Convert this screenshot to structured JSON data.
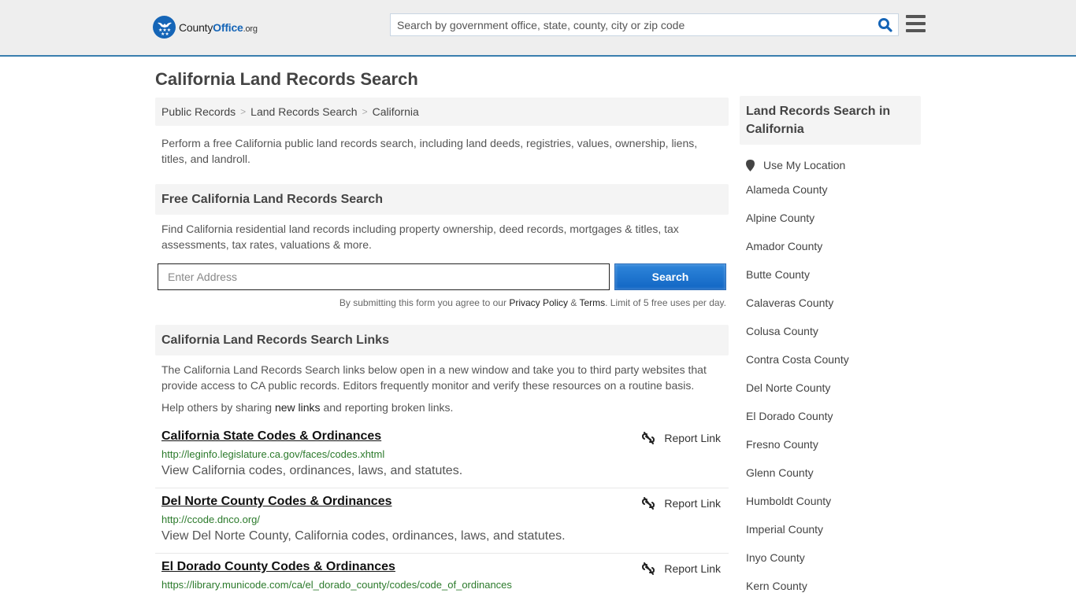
{
  "header": {
    "logo": {
      "county": "County",
      "office": "Office",
      "org": ".org"
    },
    "search_placeholder": "Search by government office, state, county, city or zip code",
    "brand_color": "#1565b7",
    "border_color": "#3a7eae"
  },
  "page_title": "California Land Records Search",
  "breadcrumb": [
    {
      "label": "Public Records"
    },
    {
      "label": "Land Records Search"
    },
    {
      "label": "California"
    }
  ],
  "intro": "Perform a free California public land records search, including land deeds, registries, values, ownership, liens, titles, and landroll.",
  "search_section": {
    "heading": "Free California Land Records Search",
    "description": "Find California residential land records including property ownership, deed records, mortgages & titles, tax assessments, tax rates, valuations & more.",
    "address_placeholder": "Enter Address",
    "button_label": "Search",
    "disclaimer_prefix": "By submitting this form you agree to our ",
    "privacy_label": "Privacy Policy",
    "amp": " & ",
    "terms_label": "Terms",
    "disclaimer_suffix": ". Limit of 5 free uses per day."
  },
  "links_section": {
    "heading": "California Land Records Search Links",
    "description": "The California Land Records Search links below open in a new window and take you to third party websites that provide access to CA public records. Editors frequently monitor and verify these resources on a routine basis.",
    "share_prefix": "Help others by sharing ",
    "share_link": "new links",
    "share_suffix": " and reporting broken links.",
    "report_label": "Report Link",
    "items": [
      {
        "title": "California State Codes & Ordinances",
        "url": "http://leginfo.legislature.ca.gov/faces/codes.xhtml",
        "description": "View California codes, ordinances, laws, and statutes."
      },
      {
        "title": "Del Norte County Codes & Ordinances",
        "url": "http://ccode.dnco.org/",
        "description": "View Del Norte County, California codes, ordinances, laws, and statutes."
      },
      {
        "title": "El Dorado County Codes & Ordinances",
        "url": "https://library.municode.com/ca/el_dorado_county/codes/code_of_ordinances",
        "description": ""
      }
    ]
  },
  "sidebar": {
    "heading": "Land Records Search in California",
    "use_location": "Use My Location",
    "counties": [
      "Alameda County",
      "Alpine County",
      "Amador County",
      "Butte County",
      "Calaveras County",
      "Colusa County",
      "Contra Costa County",
      "Del Norte County",
      "El Dorado County",
      "Fresno County",
      "Glenn County",
      "Humboldt County",
      "Imperial County",
      "Inyo County",
      "Kern County"
    ]
  }
}
